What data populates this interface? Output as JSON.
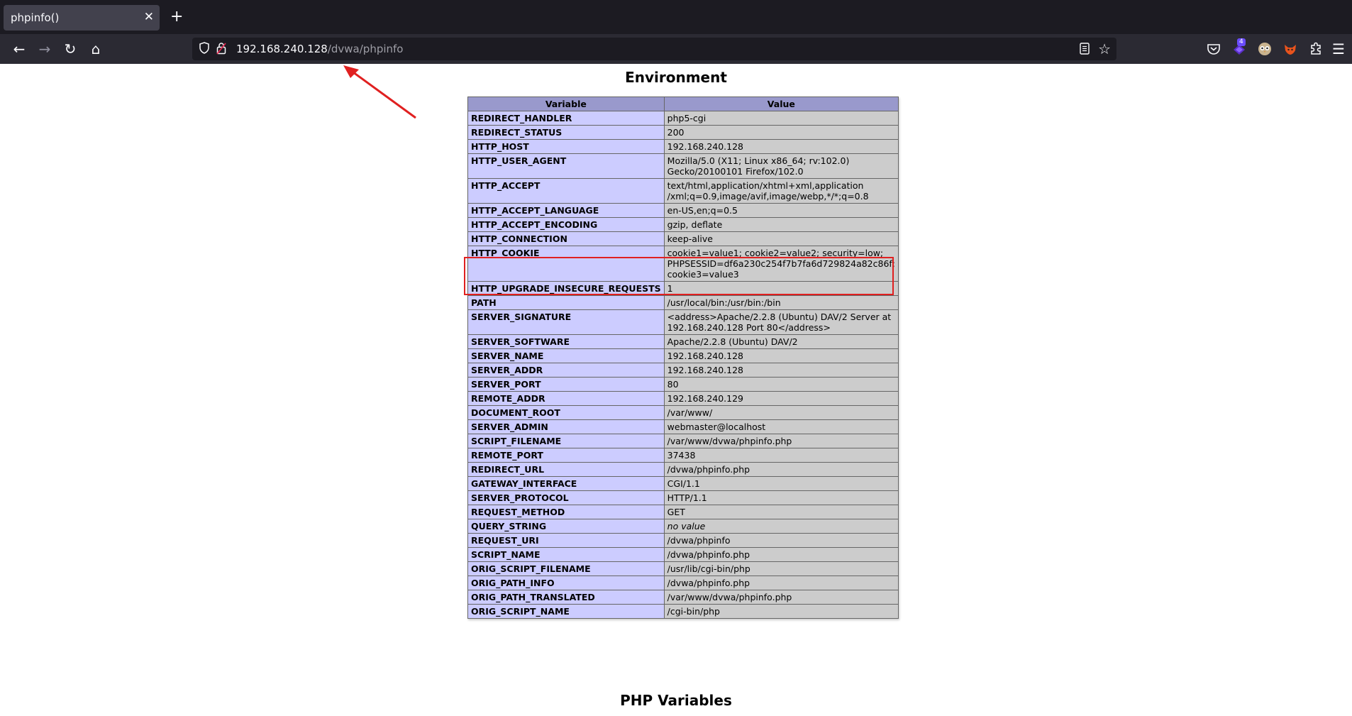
{
  "tab": {
    "title": "phpinfo()",
    "close": "✕",
    "new_tab": "+"
  },
  "nav": {
    "back": "←",
    "forward": "→",
    "reload": "↻",
    "home": "⌂"
  },
  "url": {
    "host": "192.168.240.128",
    "path": "/dvwa/phpinfo"
  },
  "toolbar": {
    "star": "☆",
    "extension_badge": "4",
    "menu": "☰"
  },
  "page": {
    "environment_title": "Environment",
    "php_variables_title": "PHP Variables",
    "table": {
      "headers": [
        "Variable",
        "Value"
      ],
      "rows": [
        {
          "name": "REDIRECT_HANDLER",
          "value": "php5-cgi"
        },
        {
          "name": "REDIRECT_STATUS",
          "value": "200"
        },
        {
          "name": "HTTP_HOST",
          "value": "192.168.240.128"
        },
        {
          "name": "HTTP_USER_AGENT",
          "value": "Mozilla/5.0 (X11; Linux x86_64; rv:102.0)\nGecko/20100101 Firefox/102.0"
        },
        {
          "name": "HTTP_ACCEPT",
          "value": "text/html,application/xhtml+xml,application\n/xml;q=0.9,image/avif,image/webp,*/*;q=0.8"
        },
        {
          "name": "HTTP_ACCEPT_LANGUAGE",
          "value": "en-US,en;q=0.5"
        },
        {
          "name": "HTTP_ACCEPT_ENCODING",
          "value": "gzip, deflate"
        },
        {
          "name": "HTTP_CONNECTION",
          "value": "keep-alive"
        },
        {
          "name": "HTTP_COOKIE",
          "value": "cookie1=value1; cookie2=value2; security=low;\nPHPSESSID=df6a230c254f7b7fa6d729824a82c86f;\ncookie3=value3"
        },
        {
          "name": "HTTP_UPGRADE_INSECURE_REQUESTS",
          "value": "1"
        },
        {
          "name": "PATH",
          "value": "/usr/local/bin:/usr/bin:/bin"
        },
        {
          "name": "SERVER_SIGNATURE",
          "value": "<address>Apache/2.2.8 (Ubuntu) DAV/2 Server at\n192.168.240.128 Port 80</address>"
        },
        {
          "name": "SERVER_SOFTWARE",
          "value": "Apache/2.2.8 (Ubuntu) DAV/2"
        },
        {
          "name": "SERVER_NAME",
          "value": "192.168.240.128"
        },
        {
          "name": "SERVER_ADDR",
          "value": "192.168.240.128"
        },
        {
          "name": "SERVER_PORT",
          "value": "80"
        },
        {
          "name": "REMOTE_ADDR",
          "value": "192.168.240.129"
        },
        {
          "name": "DOCUMENT_ROOT",
          "value": "/var/www/"
        },
        {
          "name": "SERVER_ADMIN",
          "value": "webmaster@localhost"
        },
        {
          "name": "SCRIPT_FILENAME",
          "value": "/var/www/dvwa/phpinfo.php"
        },
        {
          "name": "REMOTE_PORT",
          "value": "37438"
        },
        {
          "name": "REDIRECT_URL",
          "value": "/dvwa/phpinfo.php"
        },
        {
          "name": "GATEWAY_INTERFACE",
          "value": "CGI/1.1"
        },
        {
          "name": "SERVER_PROTOCOL",
          "value": "HTTP/1.1"
        },
        {
          "name": "REQUEST_METHOD",
          "value": "GET"
        },
        {
          "name": "QUERY_STRING",
          "value": "no value",
          "italic": true
        },
        {
          "name": "REQUEST_URI",
          "value": "/dvwa/phpinfo"
        },
        {
          "name": "SCRIPT_NAME",
          "value": "/dvwa/phpinfo.php"
        },
        {
          "name": "ORIG_SCRIPT_FILENAME",
          "value": "/usr/lib/cgi-bin/php"
        },
        {
          "name": "ORIG_PATH_INFO",
          "value": "/dvwa/phpinfo.php"
        },
        {
          "name": "ORIG_PATH_TRANSLATED",
          "value": "/var/www/dvwa/phpinfo.php"
        },
        {
          "name": "ORIG_SCRIPT_NAME",
          "value": "/cgi-bin/php"
        }
      ]
    }
  },
  "colors": {
    "header_bg": "#9999cc",
    "name_cell_bg": "#ccccff",
    "value_cell_bg": "#cccccc",
    "annotation_red": "#e02020"
  }
}
